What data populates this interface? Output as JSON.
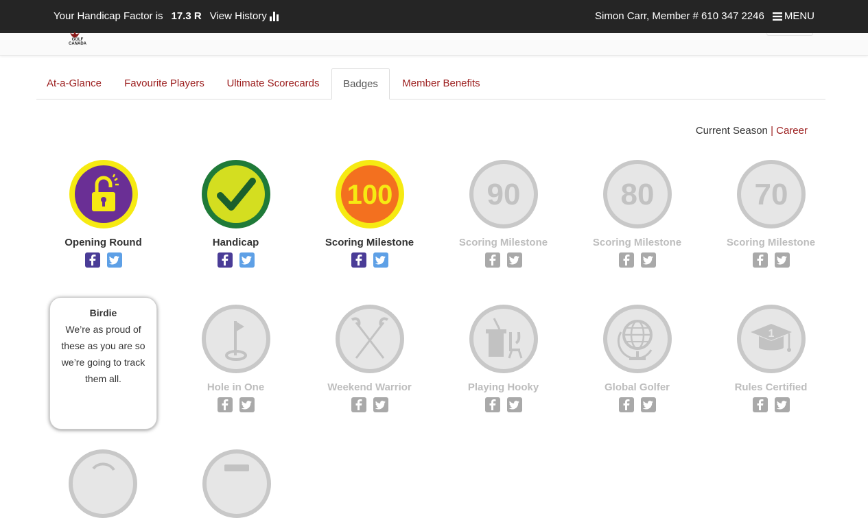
{
  "topbar": {
    "handicap_label": "Your Handicap Factor is",
    "handicap_value": "17.3 R",
    "history_label": "View History",
    "member": "Simon Carr, Member # 610 347 2246",
    "menu_label": "MENU"
  },
  "logo": {
    "text1": "GOLF",
    "text2": "CANADA"
  },
  "tabs": [
    {
      "label": "At-a-Glance"
    },
    {
      "label": "Favourite Players"
    },
    {
      "label": "Ultimate Scorecards"
    },
    {
      "label": "Badges",
      "active": true
    },
    {
      "label": "Member Benefits"
    }
  ],
  "season": {
    "current": "Current Season",
    "sep": "|",
    "career": "Career"
  },
  "badges": [
    {
      "name": "Opening Round",
      "icon": "unlock-icon",
      "earned": true
    },
    {
      "name": "Handicap",
      "icon": "checkmark-icon",
      "earned": true
    },
    {
      "name": "Scoring Milestone",
      "icon": "score-100-icon",
      "number": "100",
      "earned": true
    },
    {
      "name": "Scoring Milestone",
      "icon": "score-90-icon",
      "number": "90",
      "earned": false
    },
    {
      "name": "Scoring Milestone",
      "icon": "score-80-icon",
      "number": "80",
      "earned": false
    },
    {
      "name": "Scoring Milestone",
      "icon": "score-70-icon",
      "number": "70",
      "earned": false
    },
    {
      "name": "Hole in One",
      "icon": "flag-hole-icon",
      "earned": false
    },
    {
      "name": "Weekend Warrior",
      "icon": "crossed-clubs-icon",
      "earned": false
    },
    {
      "name": "Playing Hooky",
      "icon": "school-desk-icon",
      "earned": false
    },
    {
      "name": "Global Golfer",
      "icon": "globe-icon",
      "earned": false
    },
    {
      "name": "Rules Certified",
      "icon": "graduation-cap-icon",
      "number": "1",
      "earned": false
    }
  ],
  "tooltip": {
    "title": "Birdie",
    "description": "We’re as proud of these as you are so we’re going to track them all."
  },
  "colors": {
    "topbar": "#252525",
    "link": "#9b1c1c",
    "yellow": "#f6ea12",
    "purple": "#6a2f95",
    "green": "#1f7a38",
    "lime": "#d4de20",
    "orange": "#f3701f",
    "locked": "#c8c8c8",
    "facebook": "#4a3c97",
    "twitter": "#5ea0e6"
  }
}
